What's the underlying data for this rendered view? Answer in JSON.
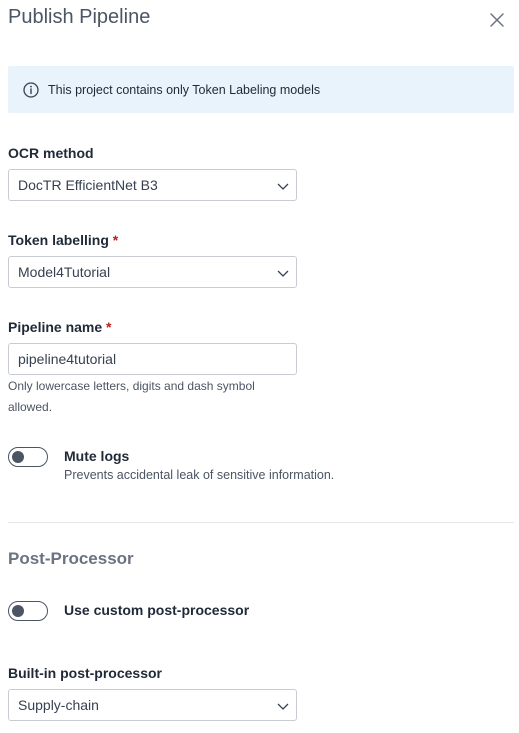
{
  "dialog": {
    "title": "Publish Pipeline"
  },
  "info": {
    "text": "This project contains only Token Labeling models"
  },
  "ocr_method": {
    "label": "OCR method",
    "value": "DocTR EfficientNet B3"
  },
  "token_labelling": {
    "label": "Token labelling",
    "required_mark": "*",
    "value": "Model4Tutorial"
  },
  "pipeline_name": {
    "label": "Pipeline name",
    "required_mark": "*",
    "value": "pipeline4tutorial",
    "hint": "Only lowercase letters, digits and dash symbol allowed."
  },
  "mute_logs": {
    "label": "Mute logs",
    "description": "Prevents accidental leak of sensitive information.",
    "enabled": false
  },
  "post_processor": {
    "section_title": "Post-Processor",
    "custom_toggle_label": "Use custom post-processor",
    "custom_enabled": false,
    "builtin_label": "Built-in post-processor",
    "builtin_value": "Supply-chain"
  },
  "colors": {
    "info_bg": "#e8f3fc",
    "required": "#b91c1c"
  }
}
